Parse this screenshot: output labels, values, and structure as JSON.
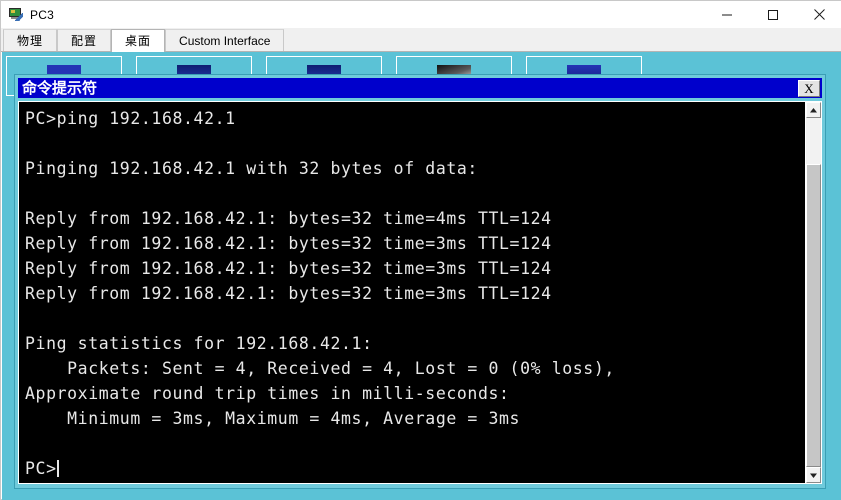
{
  "window": {
    "title": "PC3",
    "icon": "pc-device-icon",
    "controls": {
      "minimize": "minimize-icon",
      "maximize": "maximize-icon",
      "close": "close-icon"
    }
  },
  "tabs": [
    {
      "label": "物理",
      "selected": false,
      "cjk": true
    },
    {
      "label": "配置",
      "selected": false,
      "cjk": true
    },
    {
      "label": "桌面",
      "selected": true,
      "cjk": true
    },
    {
      "label": "Custom Interface",
      "selected": false,
      "cjk": false
    }
  ],
  "desktop": {
    "background_color": "#5bc2d6",
    "shortcuts": [
      {
        "name": "desktop-shortcut-1"
      },
      {
        "name": "desktop-shortcut-2"
      },
      {
        "name": "desktop-shortcut-3"
      },
      {
        "name": "desktop-shortcut-4"
      },
      {
        "name": "desktop-shortcut-5"
      }
    ]
  },
  "cmd": {
    "title": "命令提示符",
    "titlebar_color": "#0000cc",
    "close_label": "X",
    "screen": {
      "background_color": "#000000",
      "text_color": "#e8e8e8",
      "lines": [
        "PC>ping 192.168.42.1",
        "",
        "Pinging 192.168.42.1 with 32 bytes of data:",
        "",
        "Reply from 192.168.42.1: bytes=32 time=4ms TTL=124",
        "Reply from 192.168.42.1: bytes=32 time=3ms TTL=124",
        "Reply from 192.168.42.1: bytes=32 time=3ms TTL=124",
        "Reply from 192.168.42.1: bytes=32 time=3ms TTL=124",
        "",
        "Ping statistics for 192.168.42.1:",
        "    Packets: Sent = 4, Received = 4, Lost = 0 (0% loss),",
        "Approximate round trip times in milli-seconds:",
        "    Minimum = 3ms, Maximum = 4ms, Average = 3ms",
        "",
        "PC>"
      ],
      "prompt": "PC>"
    },
    "scrollbar": {
      "up_arrow": "chevron-up-icon",
      "down_arrow": "chevron-down-icon"
    }
  }
}
